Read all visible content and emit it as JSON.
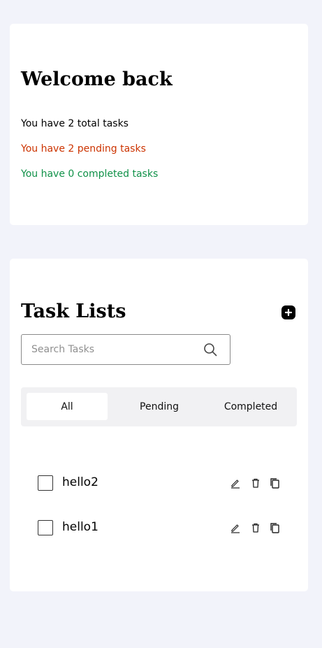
{
  "welcome": {
    "title": "Welcome back",
    "total_text": "You have 2 total tasks",
    "pending_text": "You have 2 pending tasks",
    "completed_text": "You have 0 completed tasks"
  },
  "colors": {
    "total": "#000000",
    "pending": "#cc3300",
    "completed": "#0f9148",
    "background": "#f2f3fa"
  },
  "tasks_panel": {
    "title": "Task Lists",
    "add_icon": "plus-icon",
    "search": {
      "placeholder": "Search Tasks",
      "value": "",
      "icon": "search-icon"
    },
    "tabs": [
      {
        "label": "All",
        "active": true
      },
      {
        "label": "Pending",
        "active": false
      },
      {
        "label": "Completed",
        "active": false
      }
    ],
    "tasks": [
      {
        "label": "hello2",
        "checked": false
      },
      {
        "label": "hello1",
        "checked": false
      }
    ],
    "action_icons": [
      "edit-icon",
      "delete-icon",
      "copy-icon"
    ]
  }
}
